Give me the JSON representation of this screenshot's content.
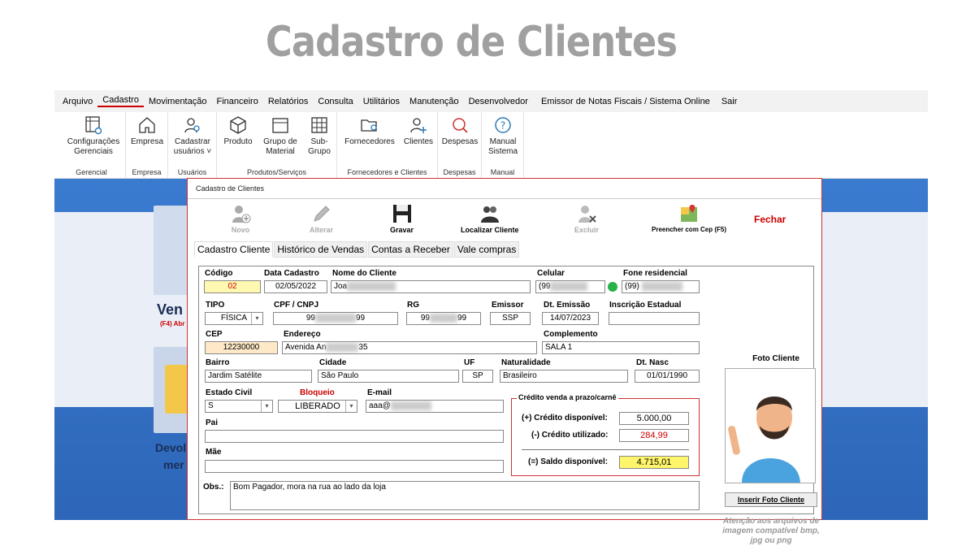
{
  "page_title": "Cadastro de Clientes",
  "menu": [
    "Arquivo",
    "Cadastro",
    "Movimentação",
    "Financeiro",
    "Relatórios",
    "Consulta",
    "Utilitários",
    "Manutenção",
    "Desenvolvedor",
    "Emissor de Notas Fiscais / Sistema Online",
    "Sair"
  ],
  "menu_active": "Cadastro",
  "ribbon": {
    "config_l1": "Configurações",
    "config_l2": "Gerenciais",
    "g_gerencial": "Gerencial",
    "empresa": "Empresa",
    "g_empresa": "Empresa",
    "usuarios_l1": "Cadastrar",
    "usuarios_l2": "usuários ˅",
    "g_usuarios": "Usuários",
    "produto": "Produto",
    "grupo_l1": "Grupo de",
    "grupo_l2": "Material",
    "sub_l1": "Sub-",
    "sub_l2": "Grupo",
    "g_produtos": "Produtos/Serviços",
    "fornecedores": "Fornecedores",
    "clientes": "Clientes",
    "g_forn": "Fornecedores e Clientes",
    "despesas": "Despesas",
    "g_despesas": "Despesas",
    "manual_l1": "Manual",
    "manual_l2": "Sistema",
    "g_manual": "Manual"
  },
  "background": {
    "venda": "Ven",
    "venda_sub": "(F4) Abr",
    "devol": "Devol",
    "mer": "mer"
  },
  "window": {
    "title": "Cadastro de Clientes",
    "toolbar": {
      "novo": "Novo",
      "alterar": "Alterar",
      "gravar": "Gravar",
      "localizar": "Localizar Cliente",
      "excluir": "Excluir",
      "cep": "Preencher com Cep (F5)",
      "fechar": "Fechar"
    },
    "tabs": [
      "Cadastro Cliente",
      "Histórico de Vendas",
      "Contas a Receber",
      "Vale compras"
    ]
  },
  "form": {
    "codigo_l": "Código",
    "codigo": "02",
    "data_l": "Data Cadastro",
    "data": "02/05/2022",
    "nome_l": "Nome do Cliente",
    "nome": "Joa",
    "celular_l": "Celular",
    "celular": "(99",
    "fone_l": "Fone residencial",
    "fone": "(99)",
    "tipo_l": "TIPO",
    "tipo": "FÍSICA",
    "cpf_l": "CPF / CNPJ",
    "cpf_a": "99",
    "cpf_b": "99",
    "rg_l": "RG",
    "rg_a": "99",
    "rg_b": "99",
    "emissor_l": "Emissor",
    "emissor": "SSP",
    "emissao_l": "Dt. Emissão",
    "emissao": "14/07/2023",
    "ie_l": "Inscrição Estadual",
    "cep_l": "CEP",
    "cep": "12230000",
    "endereco_l": "Endereço",
    "endereco_a": "Avenida An",
    "endereco_b": "35",
    "compl_l": "Complemento",
    "compl": "SALA 1",
    "bairro_l": "Bairro",
    "bairro": "Jardim Satélite",
    "cidade_l": "Cidade",
    "cidade": "São Paulo",
    "uf_l": "UF",
    "uf": "SP",
    "nat_l": "Naturalidade",
    "nat": "Brasileiro",
    "nasc_l": "Dt. Nasc",
    "nasc": "01/01/1990",
    "civil_l": "Estado Civil",
    "civil": "S",
    "bloq_l": "Bloqueio",
    "bloq": "LIBERADO",
    "email_l": "E-mail",
    "email": "aaa@",
    "pai_l": "Pai",
    "mae_l": "Mãe",
    "obs_l": "Obs.:",
    "obs": "Bom Pagador, mora na rua ao lado da loja"
  },
  "credit": {
    "title": "Crédito venda a prazo/carnê",
    "disp_l": "(+) Crédito disponível:",
    "disp": "5.000,00",
    "util_l": "(-) Crédito utilizado:",
    "util": "284,99",
    "saldo_l": "(=) Saldo disponível:",
    "saldo": "4.715,01"
  },
  "photo": {
    "title": "Foto Cliente",
    "button": "Inserir Foto Cliente",
    "note": "Atenção aos arquivos de imagem compatível bmp, jpg ou png"
  },
  "colors": {
    "accent": "#cc0000",
    "yellow": "#fff8b0",
    "blue": "#2f6fc4"
  }
}
